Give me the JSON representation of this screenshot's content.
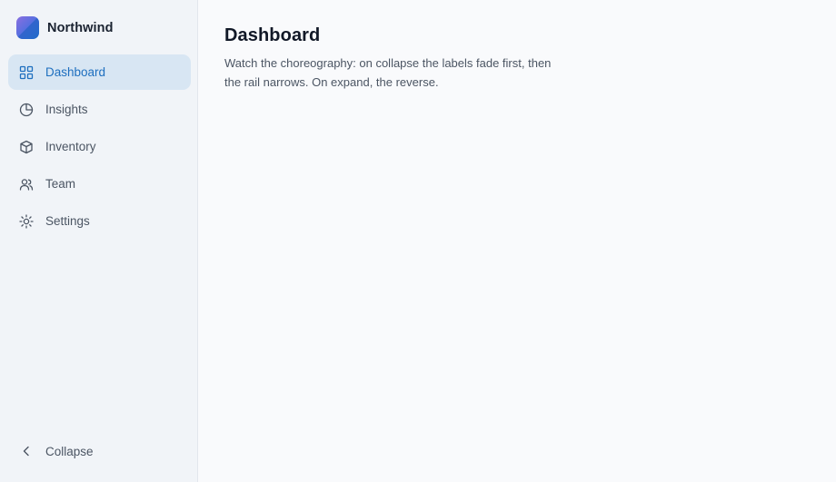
{
  "brand": {
    "name": "Northwind"
  },
  "sidebar": {
    "items": [
      {
        "label": "Dashboard",
        "icon": "grid-icon",
        "active": true
      },
      {
        "label": "Insights",
        "icon": "pie-chart-icon",
        "active": false
      },
      {
        "label": "Inventory",
        "icon": "box-icon",
        "active": false
      },
      {
        "label": "Team",
        "icon": "users-icon",
        "active": false
      },
      {
        "label": "Settings",
        "icon": "sun-gear-icon",
        "active": false
      }
    ],
    "collapse_label": "Collapse"
  },
  "main": {
    "title": "Dashboard",
    "description": "Watch the choreography: on collapse the labels fade first, then the rail narrows. On expand, the reverse."
  },
  "colors": {
    "accent": "#1e6fbf",
    "active_bg": "#d8e6f3",
    "sidebar_bg": "#f1f4f8",
    "main_bg": "#f9fafc"
  }
}
